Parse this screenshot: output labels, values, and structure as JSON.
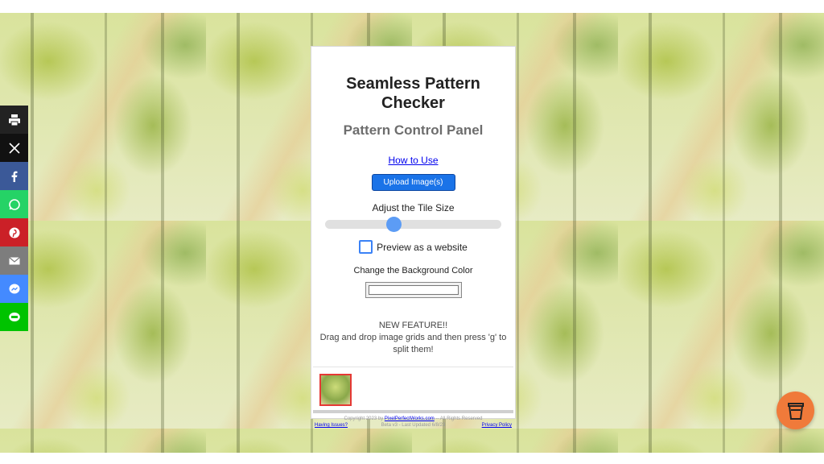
{
  "share_bar": [
    {
      "name": "print",
      "color": "#222222"
    },
    {
      "name": "x",
      "color": "#111111"
    },
    {
      "name": "facebook",
      "color": "#3b5998"
    },
    {
      "name": "whatsapp",
      "color": "#25d366"
    },
    {
      "name": "pinterest",
      "color": "#cb2027"
    },
    {
      "name": "email",
      "color": "#7d7d7d"
    },
    {
      "name": "messenger",
      "color": "#448aff"
    },
    {
      "name": "line",
      "color": "#00c300"
    }
  ],
  "panel": {
    "title": "Seamless Pattern Checker",
    "subtitle": "Pattern Control Panel",
    "how_to_use": "How to Use",
    "upload_button": "Upload Image(s)",
    "tile_size_label": "Adjust the Tile Size",
    "tile_size_value": 0.38,
    "preview_label": "Preview as a website",
    "preview_checked": false,
    "bg_color_label": "Change the Background Color",
    "bg_color_value": "#ffffff",
    "feature_heading": "NEW FEATURE!!",
    "feature_text": "Drag and drop image grids and then press 'g' to split them!"
  },
  "footer": {
    "copyright_prefix": "Copyright 2023 by",
    "copyright_link": "PixelPerfectWorks.com",
    "copyright_suffix": "-- All Rights Reserved",
    "version": "Beta v3 - Last Updated 6/8/23",
    "issues_link": "Having Issues?",
    "privacy_link": "Privacy Policy"
  },
  "accent_color": "#1a73e8",
  "support_button_color": "#f07a3a"
}
